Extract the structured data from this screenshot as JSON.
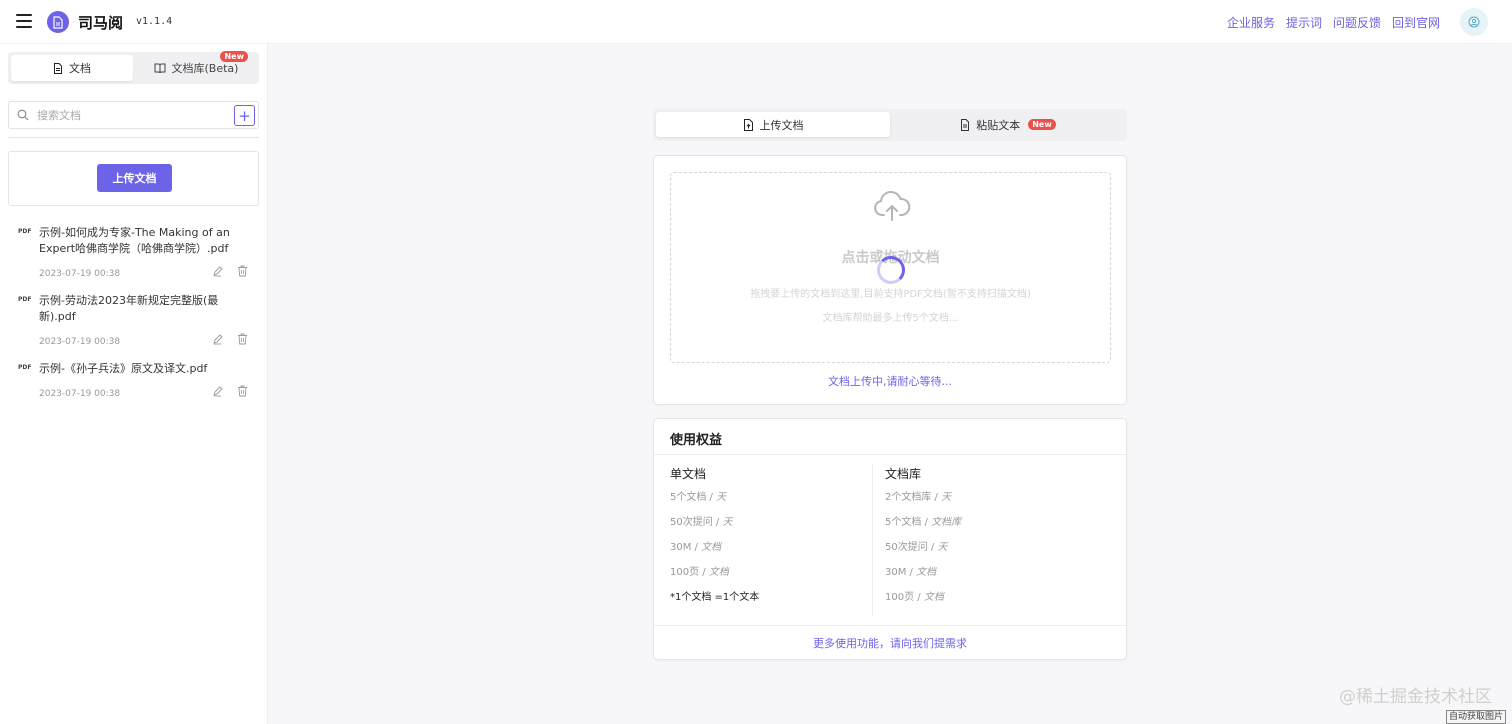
{
  "header": {
    "brand": "司马阅",
    "version": "v1.1.4",
    "nav": [
      "企业服务",
      "提示词",
      "问题反馈",
      "回到官网"
    ],
    "icons": {
      "menu": "hamburger-menu-icon",
      "logo": "document-logo-icon",
      "user": "user-avatar-icon"
    }
  },
  "sidebar": {
    "tabs": [
      {
        "label": "文档",
        "icon": "document-icon"
      },
      {
        "label": "文档库(Beta)",
        "icon": "book-icon",
        "badge": "New"
      }
    ],
    "search_placeholder": "搜索文档",
    "add_label": "+",
    "upload_button": "上传文档",
    "docs": [
      {
        "type": "PDF",
        "title": "示例-如何成为专家-The Making of an Expert哈佛商学院（哈佛商学院）.pdf",
        "date": "2023-07-19 00:38"
      },
      {
        "type": "PDF",
        "title": "示例-劳动法2023年新规定完整版(最新).pdf",
        "date": "2023-07-19 00:38"
      },
      {
        "type": "PDF",
        "title": "示例-《孙子兵法》原文及译文.pdf",
        "date": "2023-07-19 00:38"
      }
    ]
  },
  "main": {
    "tabs": [
      {
        "label": "上传文档",
        "icon": "upload-document-icon"
      },
      {
        "label": "粘贴文本",
        "icon": "paste-text-icon",
        "badge": "New"
      }
    ],
    "dropzone": {
      "title": "点击或拖动文档",
      "desc": "拖拽要上传的文档到这里,目前支持PDF文档(暂不支持扫描文档)",
      "note": "文档库帮助最多上传5个文档..."
    },
    "upload_status": "文档上传中,请耐心等待..."
  },
  "benefits": {
    "title": "使用权益",
    "single": {
      "head": "单文档",
      "items": [
        {
          "value": "5个文档",
          "unit": "天"
        },
        {
          "value": "50次提问",
          "unit": "天"
        },
        {
          "value": "30M",
          "unit": "文档"
        },
        {
          "value": "100页",
          "unit": "文档"
        }
      ],
      "note": "*1个文档 =1个文本"
    },
    "library": {
      "head": "文档库",
      "items": [
        {
          "value": "2个文档库",
          "unit": "天"
        },
        {
          "value": "5个文档",
          "unit": "文档库"
        },
        {
          "value": "50次提问",
          "unit": "天"
        },
        {
          "value": "30M",
          "unit": "文档"
        },
        {
          "value": "100页",
          "unit": "文档"
        }
      ]
    },
    "footer": "更多使用功能，请向我们提需求"
  },
  "watermark": "@稀土掘金技术社区",
  "auto_image_label": "自动获取图片",
  "colors": {
    "accent": "#6c63e8",
    "badge": "#e8524a"
  }
}
